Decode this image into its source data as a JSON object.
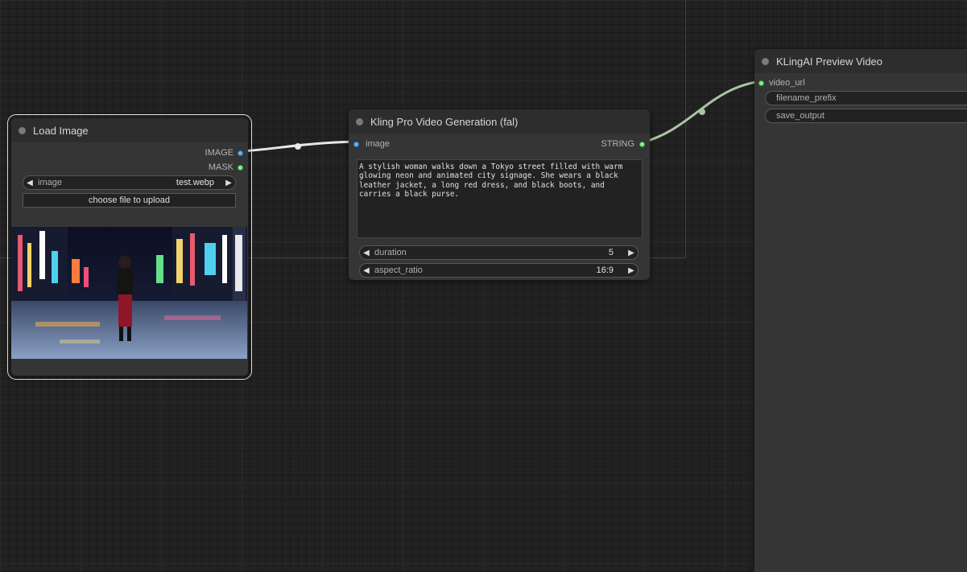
{
  "nodes": {
    "load_image": {
      "title": "Load Image",
      "outputs": {
        "image": "IMAGE",
        "mask": "MASK"
      },
      "image_widget": {
        "label": "image",
        "value": "test.webp"
      },
      "upload_label": "choose file to upload"
    },
    "kling": {
      "title": "Kling Pro Video Generation (fal)",
      "input_image": "image",
      "output_string": "STRING",
      "prompt": "A stylish woman walks down a Tokyo street filled with warm glowing neon and animated city signage. She wears a black leather jacket, a long red dress, and black boots, and carries a black purse.",
      "duration": {
        "label": "duration",
        "value": "5"
      },
      "aspect_ratio": {
        "label": "aspect_ratio",
        "value": "16:9"
      }
    },
    "preview": {
      "title": "KLingAI Preview Video",
      "input_video_url": "video_url",
      "filename_prefix": "filename_prefix",
      "save_output": "save_output"
    }
  },
  "colors": {
    "image_slot": "#64b5f6",
    "string_slot": "#7ef58b",
    "canvas_bg": "#222222",
    "node_bg": "#353535",
    "selected_outline": "#dddddd"
  },
  "icons": [
    "arrow-left-icon",
    "arrow-right-icon"
  ]
}
